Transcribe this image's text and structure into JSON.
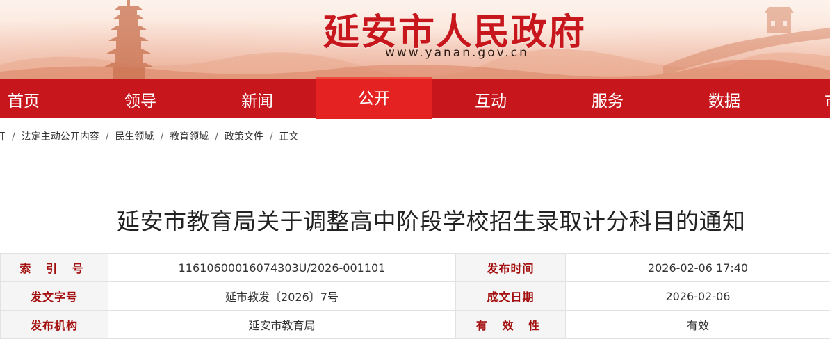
{
  "header": {
    "site_title": "延安市人民政府",
    "site_url": "www.yanan.gov.cn"
  },
  "nav": {
    "items": [
      {
        "label": "首页",
        "active": false
      },
      {
        "label": "领导",
        "active": false
      },
      {
        "label": "新闻",
        "active": false
      },
      {
        "label": "公开",
        "active": true
      },
      {
        "label": "互动",
        "active": false
      },
      {
        "label": "服务",
        "active": false
      },
      {
        "label": "数据",
        "active": false
      },
      {
        "label": "市",
        "active": false
      }
    ],
    "colors": {
      "bar": "#c8161d",
      "active": "#e42221"
    }
  },
  "breadcrumb": {
    "items": [
      "开",
      "法定主动公开内容",
      "民生领域",
      "教育领域",
      "政策文件",
      "正文"
    ],
    "separator": "/"
  },
  "document": {
    "title": "延安市教育局关于调整高中阶段学校招生录取计分科目的通知"
  },
  "meta": {
    "index_label": "索 引 号",
    "index_value": "11610600016074303U/2026-001101",
    "publish_time_label": "发布时间",
    "publish_time_value": "2026-02-06 17:40",
    "doc_number_label": "发文字号",
    "doc_number_value": "延市教发〔2026〕7号",
    "written_date_label": "成文日期",
    "written_date_value": "2026-02-06",
    "issuer_label": "发布机构",
    "issuer_value": "延安市教育局",
    "validity_label": "有 效 性",
    "validity_value": "有效"
  }
}
